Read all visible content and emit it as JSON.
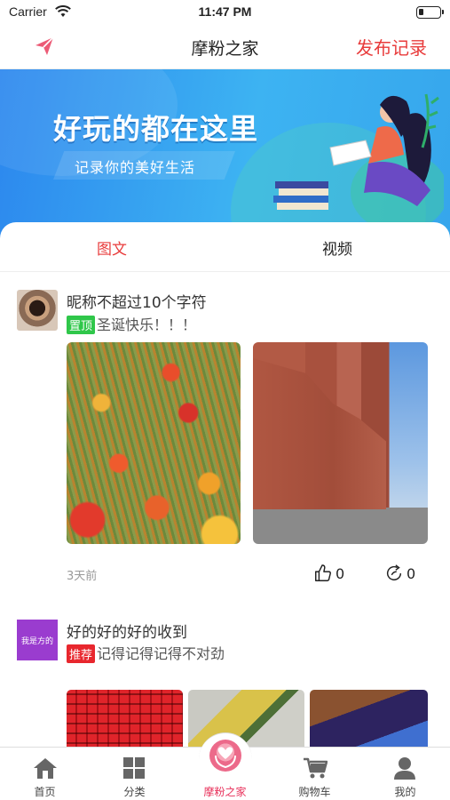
{
  "status_bar": {
    "carrier": "Carrier",
    "time": "11:47 PM"
  },
  "nav": {
    "title": "摩粉之家",
    "publish_label": "发布记录",
    "send_icon": "paper-plane-icon"
  },
  "banner": {
    "headline": "好玩的都在这里",
    "subline": "记录你的美好生活"
  },
  "tabs": [
    {
      "label": "图文",
      "active": true
    },
    {
      "label": "视频",
      "active": false
    }
  ],
  "posts": [
    {
      "nickname": "昵称不超过10个字符",
      "badge": "置顶",
      "text": "圣诞快乐！！！",
      "time": "3天前",
      "likes": "0",
      "shares": "0"
    },
    {
      "nickname": "好的好的好的收到",
      "badge": "推荐",
      "text": "记得记得记得不对劲",
      "avatar_text": "我是方的"
    }
  ],
  "tabbar": [
    {
      "label": "首页",
      "icon": "home-icon"
    },
    {
      "label": "分类",
      "icon": "grid-icon"
    },
    {
      "label": "摩粉之家",
      "icon": "community-icon",
      "active": true
    },
    {
      "label": "购物车",
      "icon": "cart-icon"
    },
    {
      "label": "我的",
      "icon": "profile-icon"
    }
  ],
  "colors": {
    "accent": "#e83b3b",
    "active_tab": "#e8305a",
    "badge_green": "#2fc74a",
    "badge_red": "#e8272e"
  }
}
